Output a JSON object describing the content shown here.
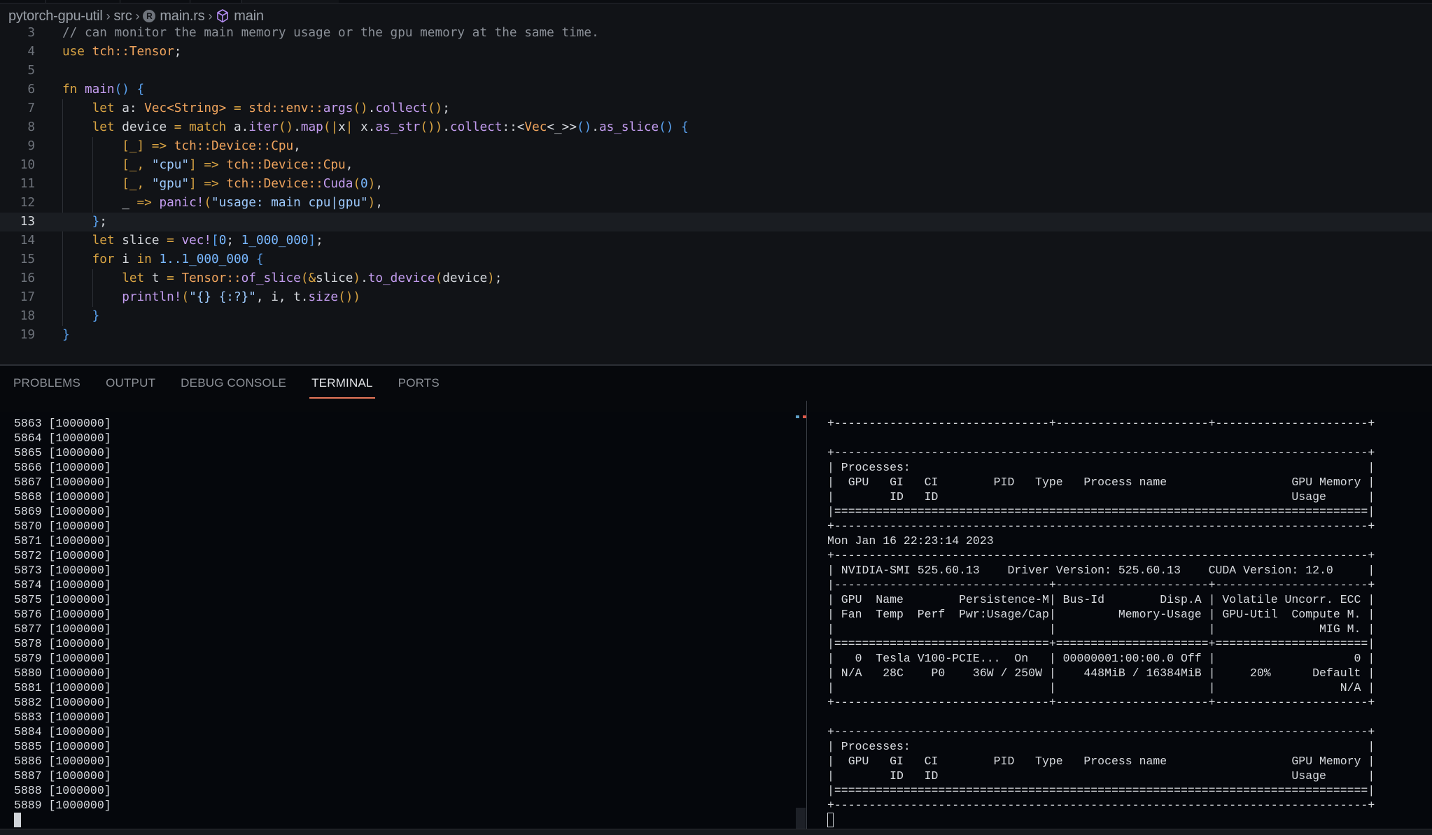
{
  "breadcrumb": {
    "items": [
      "pytorch-gpu-util",
      "src",
      "main.rs",
      "main"
    ],
    "separator": "›"
  },
  "editor": {
    "current_line": 13,
    "lines": [
      {
        "n": "3",
        "indent": 0,
        "tokens": [
          [
            "com",
            "// can monitor the main memory usage or the gpu memory at the same time."
          ]
        ]
      },
      {
        "n": "4",
        "indent": 0,
        "tokens": [
          [
            "kw",
            "use "
          ],
          [
            "ty",
            "tch::Tensor"
          ],
          [
            "tx",
            ";"
          ]
        ]
      },
      {
        "n": "5",
        "indent": 0,
        "tokens": []
      },
      {
        "n": "6",
        "indent": 0,
        "tokens": [
          [
            "kw",
            "fn "
          ],
          [
            "fn",
            "main"
          ],
          [
            "br",
            "() {"
          ]
        ]
      },
      {
        "n": "7",
        "indent": 1,
        "tokens": [
          [
            "kw",
            "let "
          ],
          [
            "tx",
            "a: "
          ],
          [
            "ty",
            "Vec<String>"
          ],
          [
            "op",
            " = "
          ],
          [
            "ty",
            "std::env::"
          ],
          [
            "fn",
            "args"
          ],
          [
            "pn",
            "()"
          ],
          [
            "tx",
            "."
          ],
          [
            "fn",
            "collect"
          ],
          [
            "pn",
            "()"
          ],
          [
            "tx",
            ";"
          ]
        ]
      },
      {
        "n": "8",
        "indent": 1,
        "tokens": [
          [
            "kw",
            "let "
          ],
          [
            "tx",
            "device "
          ],
          [
            "op",
            "= "
          ],
          [
            "kw",
            "match "
          ],
          [
            "tx",
            "a."
          ],
          [
            "fn",
            "iter"
          ],
          [
            "pn",
            "()"
          ],
          [
            "tx",
            "."
          ],
          [
            "fn",
            "map"
          ],
          [
            "pn",
            "("
          ],
          [
            "op",
            "|"
          ],
          [
            "tx",
            "x"
          ],
          [
            "op",
            "|"
          ],
          [
            "tx",
            " x."
          ],
          [
            "fn",
            "as_str"
          ],
          [
            "pn",
            "())"
          ],
          [
            "tx",
            "."
          ],
          [
            "fn",
            "collect"
          ],
          [
            "tx",
            "::<"
          ],
          [
            "ty",
            "Vec"
          ],
          [
            "tx",
            "<_>>"
          ],
          [
            "br",
            "()"
          ],
          [
            "tx",
            "."
          ],
          [
            "fn",
            "as_slice"
          ],
          [
            "br",
            "() {"
          ]
        ]
      },
      {
        "n": "9",
        "indent": 2,
        "tokens": [
          [
            "pn",
            "[_]"
          ],
          [
            "op",
            " => "
          ],
          [
            "ty",
            "tch::Device::Cpu"
          ],
          [
            "tx",
            ","
          ]
        ]
      },
      {
        "n": "10",
        "indent": 2,
        "tokens": [
          [
            "pn",
            "[_, "
          ],
          [
            "str",
            "\"cpu\""
          ],
          [
            "pn",
            "]"
          ],
          [
            "op",
            " => "
          ],
          [
            "ty",
            "tch::Device::Cpu"
          ],
          [
            "tx",
            ","
          ]
        ]
      },
      {
        "n": "11",
        "indent": 2,
        "tokens": [
          [
            "pn",
            "[_, "
          ],
          [
            "str",
            "\"gpu\""
          ],
          [
            "pn",
            "]"
          ],
          [
            "op",
            " => "
          ],
          [
            "ty",
            "tch::Device::"
          ],
          [
            "fn",
            "Cuda"
          ],
          [
            "pn",
            "("
          ],
          [
            "num",
            "0"
          ],
          [
            "pn",
            ")"
          ],
          [
            "tx",
            ","
          ]
        ]
      },
      {
        "n": "12",
        "indent": 2,
        "tokens": [
          [
            "tx",
            "_ "
          ],
          [
            "op",
            "=> "
          ],
          [
            "fn",
            "panic!"
          ],
          [
            "pn",
            "("
          ],
          [
            "str",
            "\"usage: main cpu|gpu\""
          ],
          [
            "pn",
            ")"
          ],
          [
            "tx",
            ","
          ]
        ]
      },
      {
        "n": "13",
        "indent": 1,
        "tokens": [
          [
            "br",
            "}"
          ],
          [
            "tx",
            ";"
          ]
        ]
      },
      {
        "n": "14",
        "indent": 1,
        "tokens": [
          [
            "kw",
            "let "
          ],
          [
            "tx",
            "slice "
          ],
          [
            "op",
            "= "
          ],
          [
            "fn",
            "vec!"
          ],
          [
            "br",
            "["
          ],
          [
            "num",
            "0"
          ],
          [
            "tx",
            "; "
          ],
          [
            "num",
            "1_000_000"
          ],
          [
            "br",
            "]"
          ],
          [
            "tx",
            ";"
          ]
        ]
      },
      {
        "n": "15",
        "indent": 1,
        "tokens": [
          [
            "kw",
            "for "
          ],
          [
            "tx",
            "i "
          ],
          [
            "kw",
            "in "
          ],
          [
            "num",
            "1..1_000_000"
          ],
          [
            "br",
            " {"
          ]
        ]
      },
      {
        "n": "16",
        "indent": 2,
        "tokens": [
          [
            "kw",
            "let "
          ],
          [
            "tx",
            "t "
          ],
          [
            "op",
            "= "
          ],
          [
            "ty",
            "Tensor::"
          ],
          [
            "fn",
            "of_slice"
          ],
          [
            "pn",
            "("
          ],
          [
            "op",
            "&"
          ],
          [
            "tx",
            "slice"
          ],
          [
            "pn",
            ")"
          ],
          [
            "tx",
            "."
          ],
          [
            "fn",
            "to_device"
          ],
          [
            "pn",
            "("
          ],
          [
            "tx",
            "device"
          ],
          [
            "pn",
            ")"
          ],
          [
            "tx",
            ";"
          ]
        ]
      },
      {
        "n": "17",
        "indent": 2,
        "tokens": [
          [
            "fn",
            "println!"
          ],
          [
            "pn",
            "("
          ],
          [
            "str",
            "\"{} {:?}\""
          ],
          [
            "tx",
            ", i, t."
          ],
          [
            "fn",
            "size"
          ],
          [
            "pn",
            "())"
          ]
        ]
      },
      {
        "n": "18",
        "indent": 1,
        "tokens": [
          [
            "br",
            "}"
          ]
        ]
      },
      {
        "n": "19",
        "indent": 0,
        "tokens": [
          [
            "br",
            "}"
          ]
        ]
      }
    ]
  },
  "panel": {
    "tabs": [
      {
        "label": "PROBLEMS",
        "active": false
      },
      {
        "label": "OUTPUT",
        "active": false
      },
      {
        "label": "DEBUG CONSOLE",
        "active": false
      },
      {
        "label": "TERMINAL",
        "active": true
      },
      {
        "label": "PORTS",
        "active": false
      }
    ]
  },
  "terminal_left": {
    "lines": [
      "5863 [1000000]",
      "5864 [1000000]",
      "5865 [1000000]",
      "5866 [1000000]",
      "5867 [1000000]",
      "5868 [1000000]",
      "5869 [1000000]",
      "5870 [1000000]",
      "5871 [1000000]",
      "5872 [1000000]",
      "5873 [1000000]",
      "5874 [1000000]",
      "5875 [1000000]",
      "5876 [1000000]",
      "5877 [1000000]",
      "5878 [1000000]",
      "5879 [1000000]",
      "5880 [1000000]",
      "5881 [1000000]",
      "5882 [1000000]",
      "5883 [1000000]",
      "5884 [1000000]",
      "5885 [1000000]",
      "5886 [1000000]",
      "5887 [1000000]",
      "5888 [1000000]",
      "5889 [1000000]"
    ]
  },
  "terminal_right": {
    "lines": [
      "+-------------------------------+----------------------+----------------------+",
      "",
      "+-----------------------------------------------------------------------------+",
      "| Processes:                                                                  |",
      "|  GPU   GI   CI        PID   Type   Process name                  GPU Memory |",
      "|        ID   ID                                                   Usage      |",
      "|=============================================================================|",
      "+-----------------------------------------------------------------------------+",
      "Mon Jan 16 22:23:14 2023",
      "+-----------------------------------------------------------------------------+",
      "| NVIDIA-SMI 525.60.13    Driver Version: 525.60.13    CUDA Version: 12.0     |",
      "|-------------------------------+----------------------+----------------------+",
      "| GPU  Name        Persistence-M| Bus-Id        Disp.A | Volatile Uncorr. ECC |",
      "| Fan  Temp  Perf  Pwr:Usage/Cap|         Memory-Usage | GPU-Util  Compute M. |",
      "|                               |                      |               MIG M. |",
      "|===============================+======================+======================|",
      "|   0  Tesla V100-PCIE...  On   | 00000001:00:00.0 Off |                    0 |",
      "| N/A   28C    P0    36W / 250W |    448MiB / 16384MiB |     20%      Default |",
      "|                               |                      |                  N/A |",
      "+-------------------------------+----------------------+----------------------+",
      "",
      "+-----------------------------------------------------------------------------+",
      "| Processes:                                                                  |",
      "|  GPU   GI   CI        PID   Type   Process name                  GPU Memory |",
      "|        ID   ID                                                   Usage      |",
      "|=============================================================================|",
      "+-----------------------------------------------------------------------------+"
    ]
  },
  "icons": {
    "rust_file": "rust-file-icon",
    "symbol": "symbol-method-icon"
  },
  "colors": {
    "accent_tab_underline": "#e8785a",
    "editor_bg": "#111317",
    "terminal_bg": "#05070c"
  }
}
